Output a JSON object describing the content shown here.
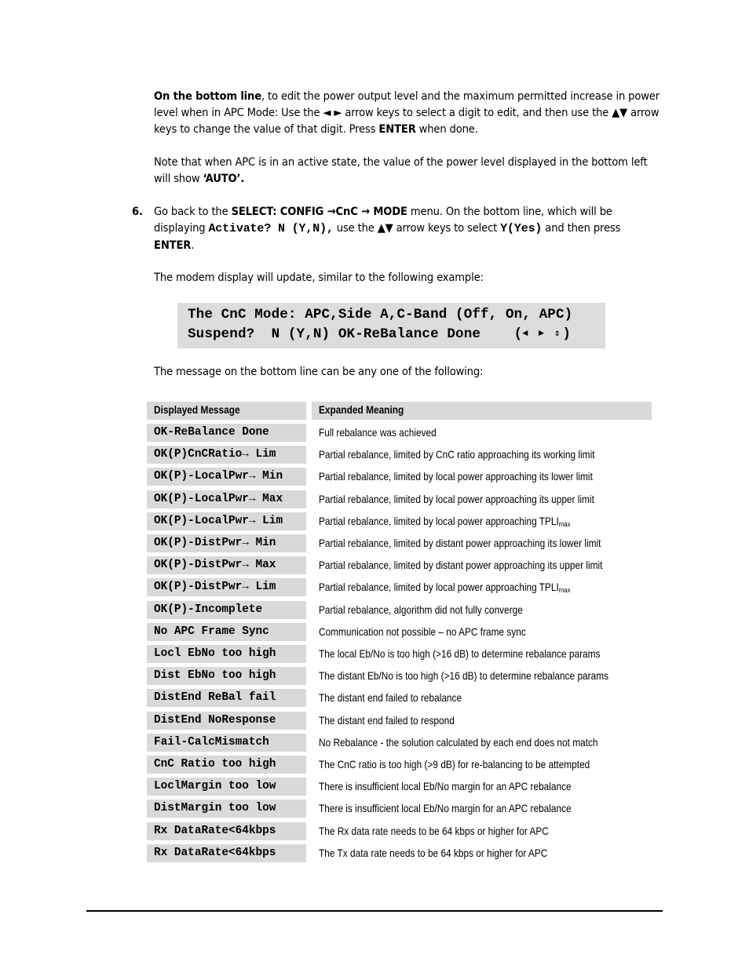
{
  "paragraphs": {
    "bottom_line": {
      "bold_lead": "On the bottom line",
      "text1": ", to edit the power output level and the maximum permitted increase in power level when in APC Mode: Use the ",
      "arrows_lr": "◄  ►",
      "text2": " arrow keys to select a digit to edit, and then use the ",
      "arrows_ud": "▲▼",
      "text3": " arrow keys to change the value of that digit. Press ",
      "enter": "ENTER",
      "text4": " when done."
    },
    "note": {
      "text": "Note that when APC is in an active state, the value of the power level displayed in the bottom left will show ",
      "bold": "‘AUTO’."
    }
  },
  "step6": {
    "number": "6.",
    "t1": "Go back to the ",
    "menu": "SELECT: CONFIG →CnC → MODE",
    "t2": " menu. On the bottom line, which will be displaying ",
    "code1": "Activate? N (Y,N),",
    "t3": "  use the ",
    "arrows": "▲▼",
    "t4": " arrow keys to select ",
    "code2": "Y(Yes)",
    "t5": " and then press ",
    "enter": "ENTER",
    "t6": ".",
    "update_text": "The modem display will update, similar to the following example:"
  },
  "lcd": {
    "line1": "The CnC Mode: APC,Side A,C-Band (Off, On, APC)",
    "line2_prefix": "Suspend?  N (Y,N) OK-ReBalance Done    (",
    "line2_arrows": "◄ ► ⇕",
    "line2_suffix": ")"
  },
  "table_intro": "The message on the bottom line can be any one of the following:",
  "table": {
    "headers": [
      "Displayed Message",
      "Expanded Meaning"
    ],
    "rows": [
      {
        "msg": "OK-ReBalance Done",
        "meaning": "Full rebalance was achieved"
      },
      {
        "msg": "OK(P)CnCRatio→ Lim",
        "meaning": "Partial rebalance, limited by CnC ratio approaching its working limit"
      },
      {
        "msg": "OK(P)-LocalPwr→ Min",
        "meaning": "Partial rebalance, limited by local power approaching its lower limit"
      },
      {
        "msg": "OK(P)-LocalPwr→ Max",
        "meaning": "Partial rebalance, limited by local power approaching its upper limit"
      },
      {
        "msg": "OK(P)-LocalPwr→ Lim",
        "meaning": "Partial rebalance, limited by local power approaching TPLI",
        "sub": "max"
      },
      {
        "msg": "OK(P)-DistPwr→ Min",
        "meaning": "Partial rebalance, limited by distant power approaching its lower limit"
      },
      {
        "msg": "OK(P)-DistPwr→ Max",
        "meaning": "Partial rebalance, limited by distant power approaching its upper limit"
      },
      {
        "msg": "OK(P)-DistPwr→ Lim",
        "meaning": "Partial rebalance, limited by local power approaching TPLI",
        "sub": "max"
      },
      {
        "msg": "OK(P)-Incomplete",
        "meaning": "Partial rebalance, algorithm did not fully converge"
      },
      {
        "msg": "No APC Frame Sync",
        "meaning": "Communication not possible – no APC frame sync"
      },
      {
        "msg": "Locl EbNo too high",
        "meaning": "The local Eb/No is too high (>16 dB) to determine rebalance params"
      },
      {
        "msg": "Dist EbNo too high",
        "meaning": "The distant Eb/No is too high (>16 dB) to determine rebalance params"
      },
      {
        "msg": "DistEnd ReBal fail",
        "meaning": "The distant end failed to rebalance"
      },
      {
        "msg": "DistEnd NoResponse",
        "meaning": "The distant end failed to respond"
      },
      {
        "msg": "Fail-CalcMismatch",
        "meaning": "No Rebalance - the solution calculated by each end does not match"
      },
      {
        "msg": "CnC Ratio too high",
        "meaning": "The CnC ratio is too high (>9 dB) for re-balancing to be attempted"
      },
      {
        "msg": "LoclMargin too low",
        "meaning": "There is insufficient local Eb/No margin for an APC rebalance"
      },
      {
        "msg": "DistMargin too low",
        "meaning": "There is insufficient local Eb/No margin for an APC rebalance"
      },
      {
        "msg": "Rx DataRate<64kbps",
        "meaning": "The Rx data rate needs to be 64 kbps or higher for APC"
      },
      {
        "msg": "Rx DataRate<64kbps",
        "meaning": "The Tx data rate needs to be 64 kbps or higher for APC"
      }
    ]
  },
  "colors": {
    "cell_gray": "#d9d9d9",
    "lcd_gray": "#dcdcdc",
    "text": "#000000"
  }
}
